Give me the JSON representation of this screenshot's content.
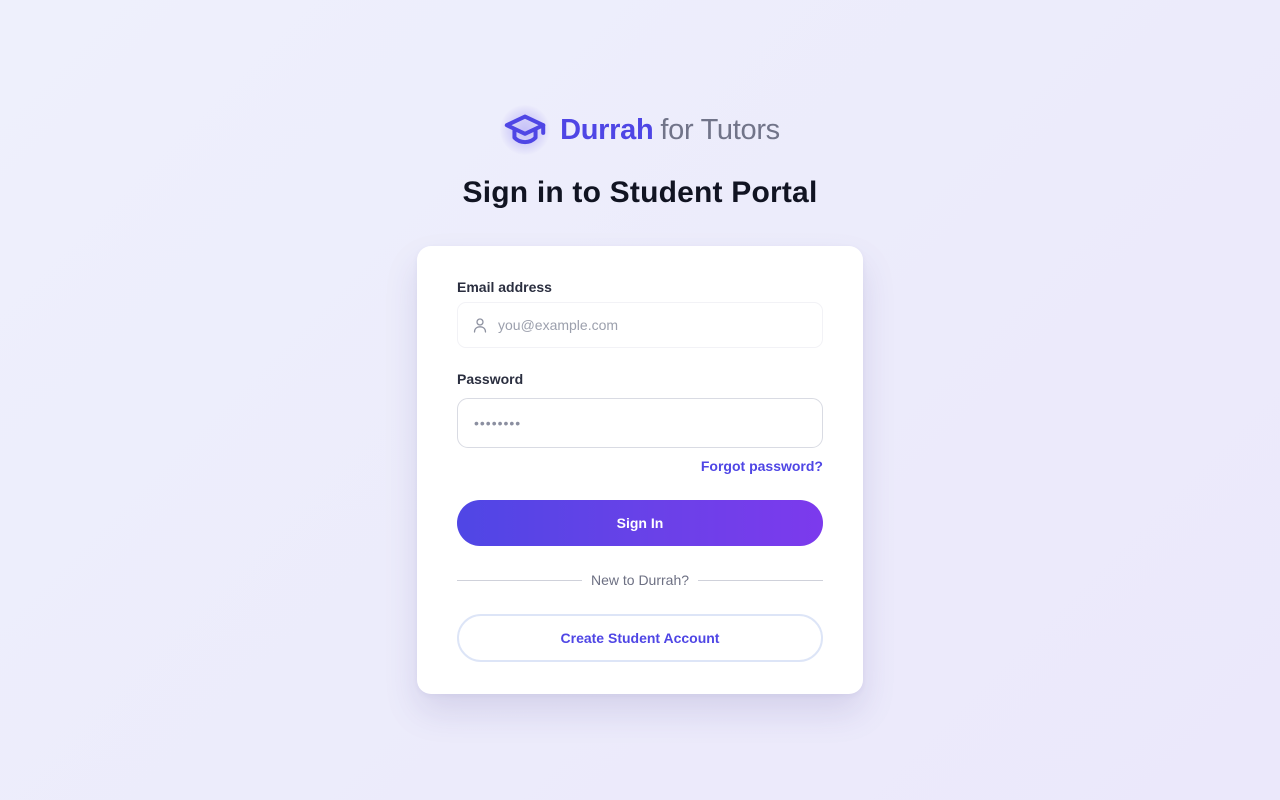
{
  "brand": {
    "name": "Durrah",
    "suffix": "for Tutors",
    "icon": "graduation-cap-icon",
    "accent_color": "#4f46e5"
  },
  "page": {
    "title": "Sign in to Student Portal"
  },
  "form": {
    "email_label": "Email address",
    "email_placeholder": "you@example.com",
    "email_icon": "user-icon",
    "password_label": "Password",
    "password_placeholder": "••••••••",
    "forgot_password_label": "Forgot password?",
    "sign_in_label": "Sign In",
    "divider_text": "New to Durrah?",
    "create_account_label": "Create Student Account"
  },
  "colors": {
    "primary": "#4f46e5",
    "primary_gradient_end": "#7c3aed",
    "background": "#eeeefc"
  }
}
